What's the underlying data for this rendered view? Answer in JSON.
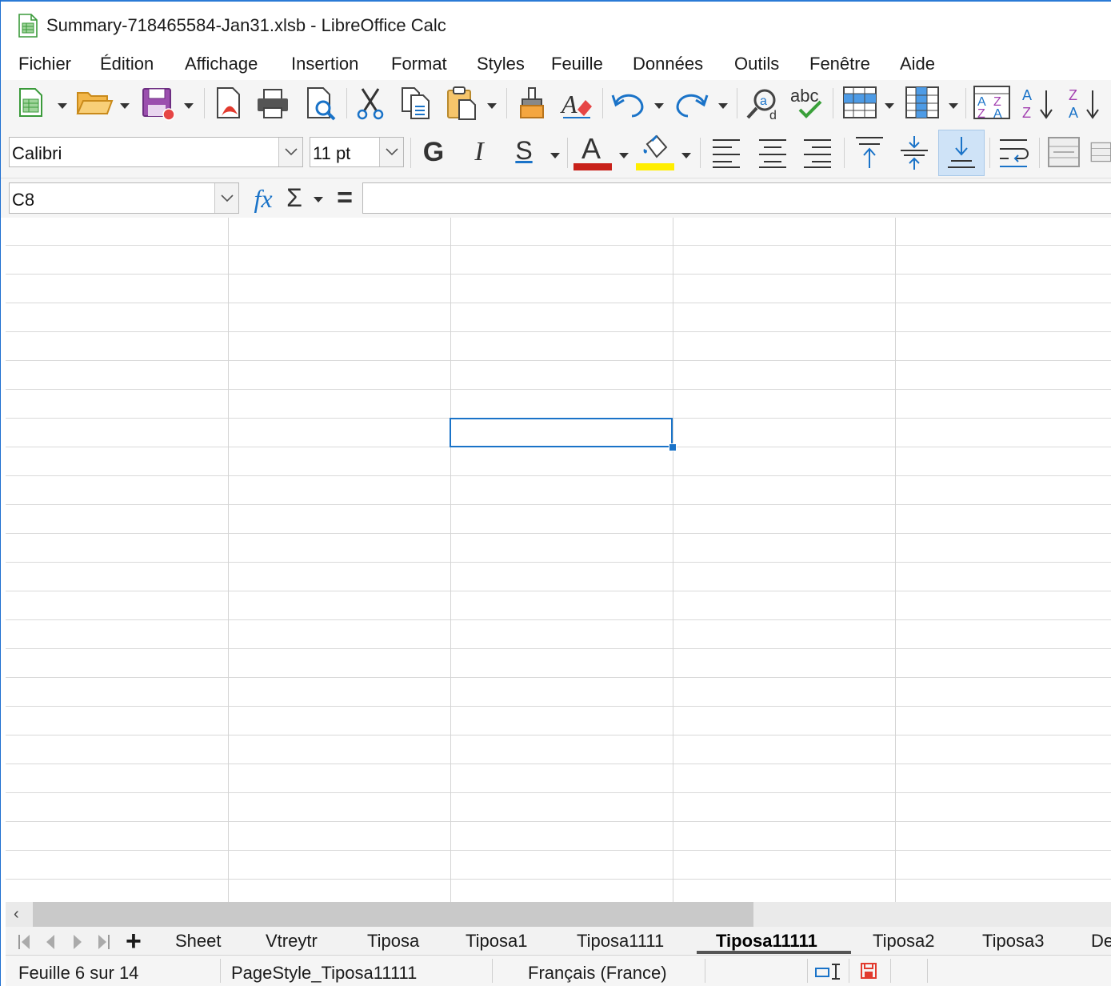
{
  "window": {
    "title": "Summary-718465584-Jan31.xlsb - LibreOffice Calc"
  },
  "menu": [
    "Fichier",
    "Édition",
    "Affichage",
    "Insertion",
    "Format",
    "Styles",
    "Feuille",
    "Données",
    "Outils",
    "Fenêtre",
    "Aide"
  ],
  "toolbar_standard": {
    "icons": [
      "new-spreadsheet-icon",
      "open-folder-icon",
      "save-icon",
      "export-pdf-icon",
      "print-icon",
      "print-preview-icon",
      "cut-icon",
      "copy-icon",
      "paste-icon",
      "clone-formatting-icon",
      "clear-formatting-icon",
      "undo-icon",
      "redo-icon",
      "find-replace-icon",
      "spelling-icon",
      "row-icon",
      "column-icon",
      "sort-icon",
      "sort-ascending-icon",
      "sort-descending-icon"
    ]
  },
  "toolbar_formatting": {
    "font_name": "Calibri",
    "font_size": "11 pt",
    "bold_label": "G",
    "italic_label": "I",
    "underline_label": "S",
    "font_color_label": "A",
    "font_color": "#c8211a",
    "highlight_color": "#ffee00",
    "align_bottom_active": true
  },
  "formula_bar": {
    "cell_reference": "C8",
    "function_wizard": "fx",
    "sum_symbol": "Σ",
    "equals_symbol": "=",
    "content": ""
  },
  "grid": {
    "active_cell": "C8"
  },
  "sheet_tabs": {
    "add_label": "+",
    "tabs": [
      "Sheet",
      "Vtreytr",
      "Tiposa",
      "Tiposa1",
      "Tiposa1111",
      "Tiposa11111",
      "Tiposa2",
      "Tiposa3",
      "De"
    ],
    "active": "Tiposa11111"
  },
  "status_bar": {
    "sheet_position": "Feuille 6 sur 14",
    "page_style": "PageStyle_Tiposa11111",
    "language": "Français (France)"
  }
}
